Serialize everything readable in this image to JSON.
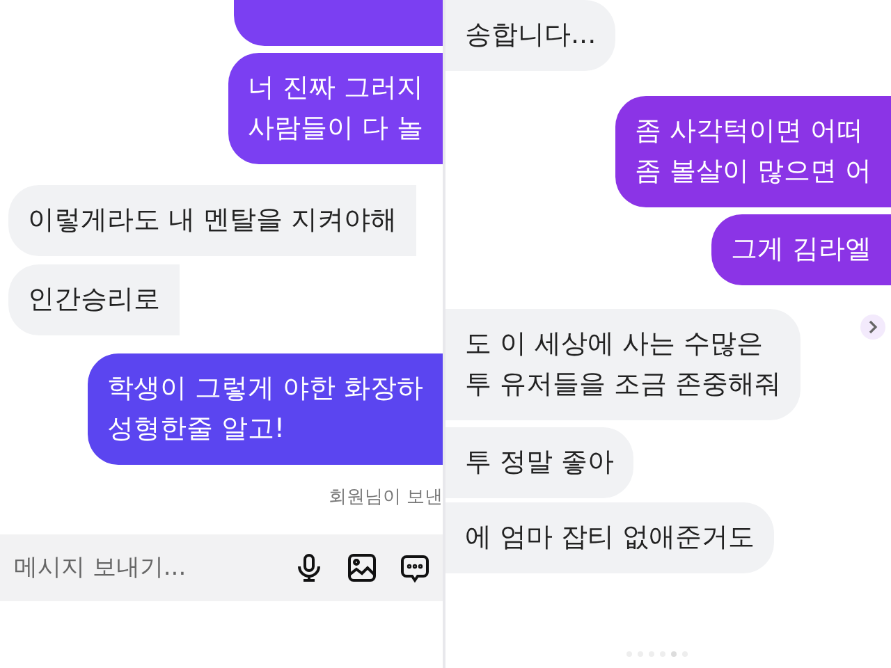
{
  "left_panel": {
    "messages": [
      {
        "kind": "sent",
        "color": "#7b3ff2"
      },
      {
        "kind": "sent",
        "color": "#7b3ff2",
        "text": "너 진짜 그러지\n사람들이 다 놀"
      },
      {
        "kind": "received",
        "text": "이렇게라도 내 멘탈을 지켜야해"
      },
      {
        "kind": "received",
        "text": "인간승리로"
      },
      {
        "kind": "sent",
        "color": "#5b45f0",
        "text": "학생이 그렇게 야한 화장하\n성형한줄 알고!"
      }
    ],
    "status": "회원님이 보낸",
    "composer": {
      "placeholder": "메시지 보내기..."
    }
  },
  "right_panel": {
    "messages": [
      {
        "kind": "received",
        "text": "송합니다..."
      },
      {
        "kind": "sent",
        "color": "#8b34e6",
        "text": "좀 사각턱이면 어떠\n좀 볼살이 많으면 어"
      },
      {
        "kind": "sent",
        "color": "#8b34e6",
        "text": "그게 김라엘"
      },
      {
        "kind": "received",
        "text": "도 이 세상에 사는 수많은\n투 유저들을 조금 존중해줘"
      },
      {
        "kind": "received",
        "text": "투 정말 좋아"
      },
      {
        "kind": "received",
        "text": "에 엄마 잡티 없애준거도"
      }
    ]
  }
}
